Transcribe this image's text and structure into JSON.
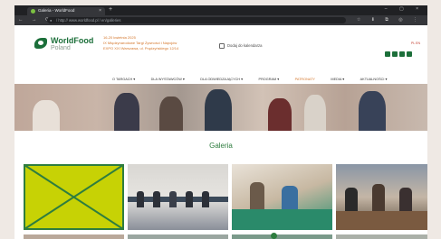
{
  "browser": {
    "tab_title": "Galeria - WorldFood",
    "new_tab_symbol": "+",
    "close_symbol": "×",
    "window_controls": "– ▢ ×",
    "nav_buttons": "← → ⟳ ⌂",
    "url_host": "www.worldfood.pl",
    "url_path": "/ http:// www.worldfood.pl / en/galleries",
    "ext_icons": "☆ ⬇ ⧉ ◎ ⋮"
  },
  "site": {
    "logo_name": "WorldFood",
    "logo_sub": "Poland",
    "event_dates": "16-20 kwietnia 2025",
    "event_name": "IX Międzynarodowe Targi Żywności i Napojów",
    "event_place": "EXPO XXI Warszawa, ul. Prądzyńskiego 12/14",
    "calendar_label": "Dodaj do kalendarza",
    "lang": "PL EN",
    "nav": [
      {
        "label": "O TARGACH ▾"
      },
      {
        "label": "DLA WYSTAWCÓW ▾"
      },
      {
        "label": "DLA ODWIEDZAJĄCYCH ▾"
      },
      {
        "label": "PROGRAM ▾"
      },
      {
        "label": "PATRONATY"
      },
      {
        "label": "MEDIA ▾"
      },
      {
        "label": "AKTUALNOŚCI ▾"
      }
    ],
    "active_nav_index": 4,
    "gallery_title": "Galeria"
  },
  "colors": {
    "brand_green": "#1c6f3a",
    "accent_orange": "#d4762b",
    "placeholder_yellow": "#c7d205"
  },
  "icons": {
    "social": [
      "linkedin-icon",
      "facebook-icon",
      "instagram-icon",
      "youtube-icon"
    ],
    "calendar": "calendar-icon",
    "fullscreen": "fullscreen-icon"
  }
}
